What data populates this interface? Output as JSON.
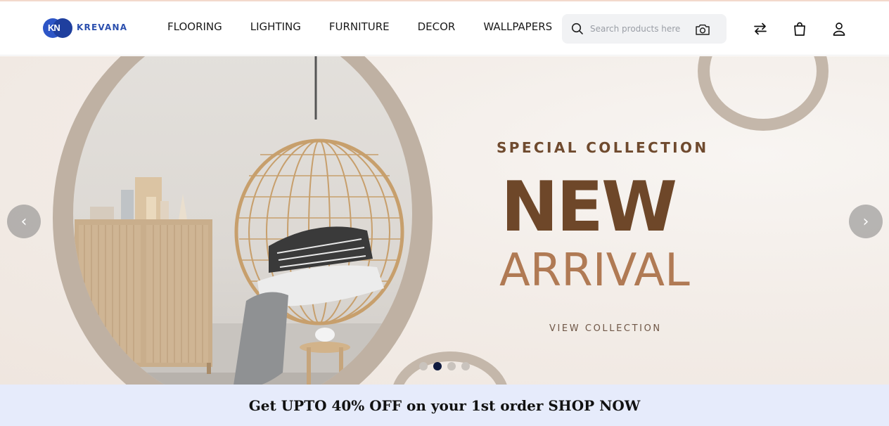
{
  "brand": {
    "name": "KREVANA",
    "monogram": "KN",
    "colors": {
      "primary": "#2b4fae",
      "accent": "#6e4729"
    }
  },
  "nav": {
    "items": [
      {
        "label": "FLOORING"
      },
      {
        "label": "LIGHTING"
      },
      {
        "label": "FURNITURE"
      },
      {
        "label": "DECOR"
      },
      {
        "label": "WALLPAPERS"
      }
    ]
  },
  "search": {
    "placeholder": "Search products here",
    "value": "",
    "icon": "search-icon",
    "camera_icon": "camera-icon"
  },
  "header_icons": [
    "compare-arrows-icon",
    "shopping-bag-icon",
    "user-icon"
  ],
  "hero": {
    "eyebrow": "SPECIAL COLLECTION",
    "headline": "NEW",
    "subheadline": "ARRIVAL",
    "cta": "VIEW COLLECTION",
    "prev_icon": "chevron-left-icon",
    "next_icon": "chevron-right-icon",
    "prev_glyph": "‹",
    "next_glyph": "›",
    "slide_count": 4,
    "active_slide": 2
  },
  "promo": {
    "text": "Get UPTO 40% OFF on your 1st order SHOP NOW"
  }
}
